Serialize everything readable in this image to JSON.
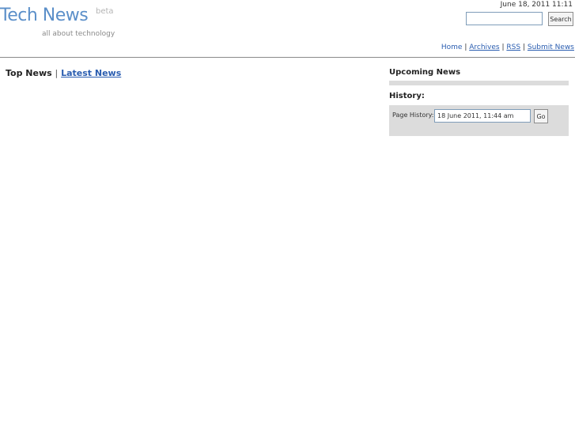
{
  "header": {
    "site_title": "Tech News",
    "badge": "beta",
    "tagline": "all about technology",
    "datetime": "June 18, 2011 11:11"
  },
  "search": {
    "value": "",
    "placeholder": "",
    "button_label": "Search"
  },
  "nav": {
    "separator": "|",
    "items": [
      {
        "label": "Home"
      },
      {
        "label": "Archives"
      },
      {
        "label": "RSS"
      },
      {
        "label": "Submit News"
      }
    ]
  },
  "tabs": {
    "separator": "|",
    "items": [
      {
        "label": "Top News",
        "active": true
      },
      {
        "label": "Latest News",
        "active": false
      }
    ]
  },
  "sidebar": {
    "upcoming_title": "Upcoming News",
    "history_title": "History:",
    "history_label": "Page History:",
    "history_value": "18 June 2011, 11:44 am",
    "go_label": "Go"
  },
  "colors": {
    "title_blue": "#5b8fc9",
    "link_blue": "#2a5db0",
    "panel_gray": "#dcdcdc"
  }
}
